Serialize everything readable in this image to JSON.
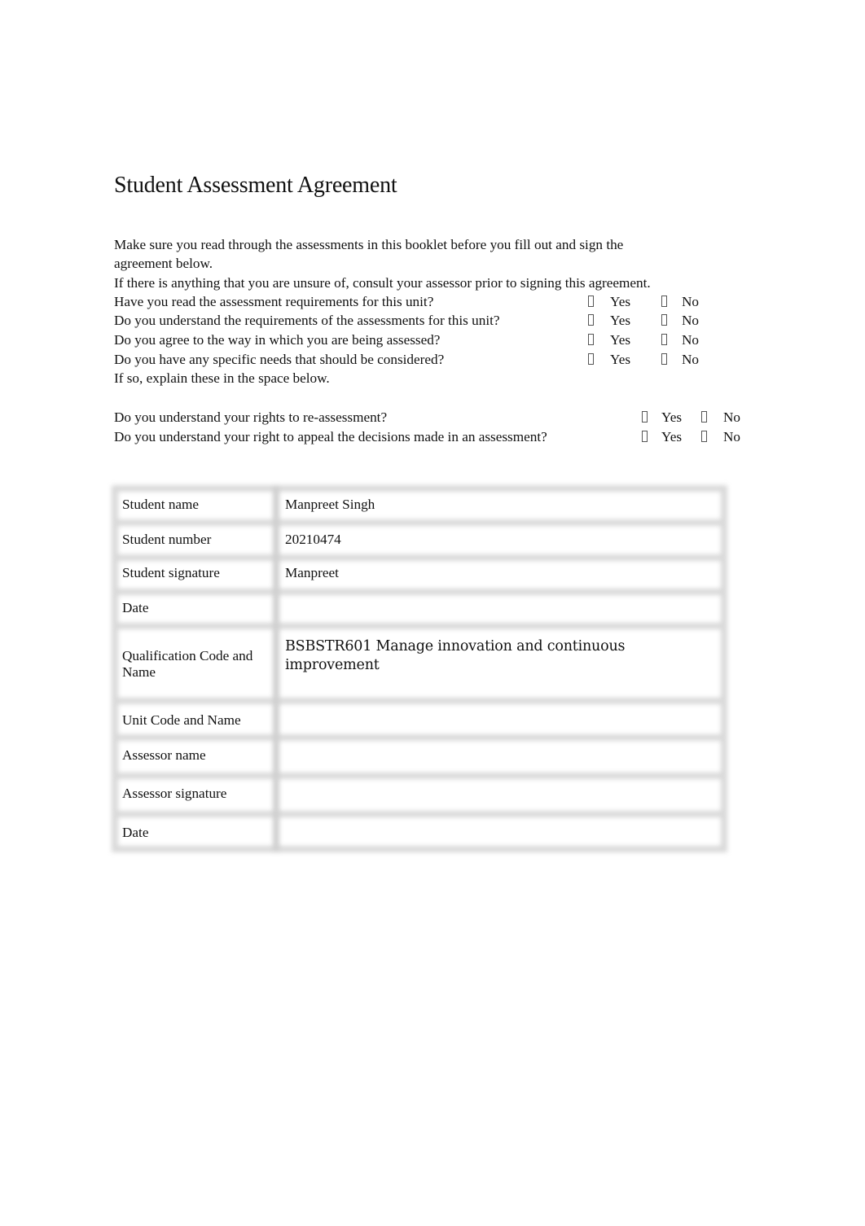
{
  "page_title": "Student Assessment Agreement",
  "intro": {
    "line1": "Make sure you read through the assessments in this booklet before you fill out and sign the",
    "line2": "agreement below.",
    "line3": "If there is anything that you are unsure of, consult your assessor prior to signing this agreement."
  },
  "questions": [
    {
      "text": "Have you read the assessment requirements for this unit?",
      "yes": "Yes",
      "no": "No"
    },
    {
      "text": "Do you understand the requirements of the assessments for this unit?",
      "yes": "Yes",
      "no": "No"
    },
    {
      "text": "Do you agree to the way in which you are being assessed?",
      "yes": "Yes",
      "no": "No"
    },
    {
      "text": "Do you have any specific needs that should be considered?",
      "yes": "Yes",
      "no": "No"
    }
  ],
  "explain_note": "If so, explain these in the space below.",
  "rights_questions": [
    {
      "text": "Do you understand your rights to re-assessment?",
      "yes": "Yes",
      "no": "No"
    },
    {
      "text": "Do you understand your right to appeal the decisions made in an assessment?",
      "yes": "Yes",
      "no": "No"
    }
  ],
  "details_table": [
    {
      "label": "Student name",
      "value": "Manpreet Singh"
    },
    {
      "label": "Student number",
      "value": "20210474"
    },
    {
      "label": "Student signature",
      "value": "Manpreet"
    },
    {
      "label": "Date",
      "value": ""
    },
    {
      "label": "Qualification Code and Name",
      "value": "BSBSTR601 Manage innovation and continuous improvement"
    },
    {
      "label": "Unit Code and Name",
      "value": ""
    },
    {
      "label": "Assessor name",
      "value": ""
    },
    {
      "label": "Assessor signature",
      "value": ""
    },
    {
      "label": "Date",
      "value": ""
    }
  ],
  "icons": {
    "checkbox": "checkbox-icon"
  }
}
